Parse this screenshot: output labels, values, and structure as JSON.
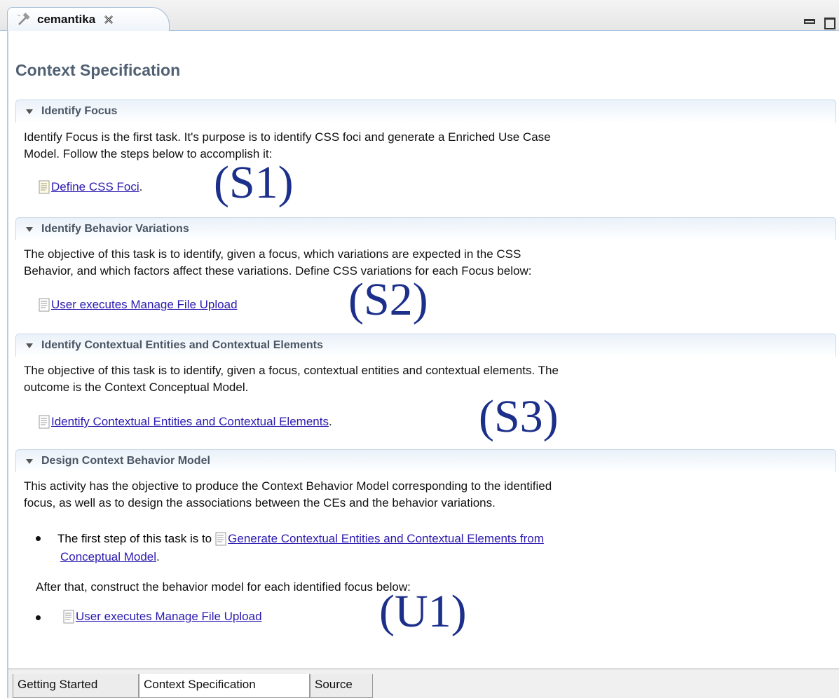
{
  "editor_tab": {
    "title": "cemantika",
    "icon": "hammer-icon",
    "close_icon": "close-icon"
  },
  "window_controls": {
    "minimize": "minimize-icon",
    "maximize": "maximize-icon"
  },
  "page_title": "Context Specification",
  "sections": [
    {
      "title": "Identify Focus",
      "description_lines": [
        "Identify Focus is the first task. It's purpose is to identify CSS foci and generate a Enriched Use Case",
        "Model. Follow the steps below to accomplish it:"
      ],
      "link": "Define CSS Foci",
      "link_suffix": ".",
      "annotation": "(S1)"
    },
    {
      "title": "Identify Behavior Variations",
      "description_lines": [
        "The objective of this task is to identify, given a focus, which variations are expected in the CSS",
        "Behavior, and which factors affect these variations. Define CSS variations for each Focus below:"
      ],
      "link": "User executes Manage File Upload",
      "annotation": "(S2)"
    },
    {
      "title": "Identify Contextual Entities and Contextual Elements",
      "description_lines": [
        "The objective of this task is to identify, given a focus, contextual entities and contextual elements. The",
        "outcome is the Context Conceptual Model."
      ],
      "link": "Identify Contextual Entities and Contextual Elements",
      "link_suffix": ".",
      "annotation": "(S3)"
    },
    {
      "title": "Design Context Behavior Model",
      "description_lines": [
        "This activity has the objective to produce the Context Behavior Model corresponding to the identified",
        "focus, as well as to design the associations between the CEs and the behavior variations."
      ],
      "bullet1_prefix": "The first step of this task is to",
      "bullet1_link_line1": "Generate Contextual Entities and Contextual Elements from",
      "bullet1_link_line2": "Conceptual Model",
      "bullet1_suffix": ".",
      "after_text": "After that, construct the behavior model for each identified focus below:",
      "bullet2_link": "User executes Manage File Upload",
      "annotation": "(U1)"
    }
  ],
  "bottom_tabs": [
    {
      "label": "Getting Started",
      "active": false
    },
    {
      "label": "Context Specification",
      "active": true
    },
    {
      "label": "Source",
      "active": false
    }
  ]
}
